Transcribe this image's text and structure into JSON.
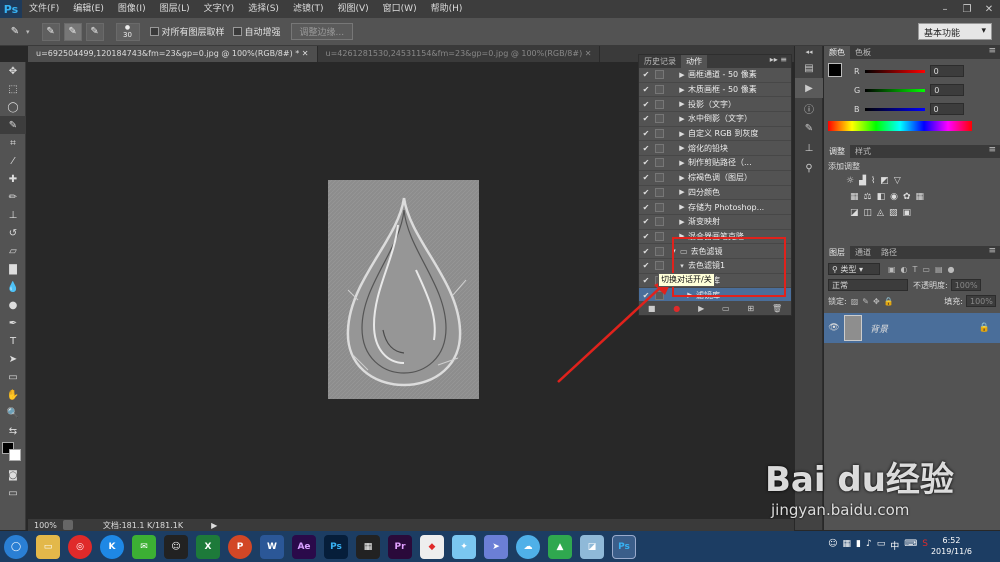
{
  "app": {
    "logo": "Ps"
  },
  "menu": [
    "文件(F)",
    "编辑(E)",
    "图像(I)",
    "图层(L)",
    "文字(Y)",
    "选择(S)",
    "滤镜(T)",
    "视图(V)",
    "窗口(W)",
    "帮助(H)"
  ],
  "options": {
    "brush_size": "30",
    "sample_all_layers": "对所有图层取样",
    "auto_enhance": "自动增强",
    "refine_edge": "调整边缘...",
    "workspace": "基本功能"
  },
  "doc_tabs": [
    "u=692504499,120184743&fm=23&gp=0.jpg @ 100%(RGB/8#) *",
    "u=4261281530,24531154&fm=23&gp=0.jpg @ 100%(RGB/8#)"
  ],
  "status": {
    "zoom": "100%",
    "doc_info": "文档:181.1 K/181.1K"
  },
  "actions_panel": {
    "tabs": [
      "历史记录",
      "动作"
    ],
    "rows": [
      {
        "label": "画框通道 - 50 像素"
      },
      {
        "label": "木质画框 - 50 像素"
      },
      {
        "label": "投影（文字）"
      },
      {
        "label": "水中倒影（文字）"
      },
      {
        "label": "自定义 RGB 到灰度"
      },
      {
        "label": "熔化的铅块"
      },
      {
        "label": "制作剪贴路径（..."
      },
      {
        "label": "棕褐色调（图层）"
      },
      {
        "label": "四分颜色"
      },
      {
        "label": "存储为 Photoshop..."
      },
      {
        "label": "渐变映射"
      },
      {
        "label": "混合器画笔克隆..."
      },
      {
        "label": "去色滤镜"
      },
      {
        "label": "去色滤镜1"
      },
      {
        "label": "滤镜库"
      },
      {
        "label": "滤镜库"
      }
    ],
    "tooltip": "切换对话开/关"
  },
  "color_panel": {
    "tabs": [
      "颜色",
      "色板"
    ],
    "r_label": "R",
    "g_label": "G",
    "b_label": "B",
    "r": "0",
    "g": "0",
    "b": "0"
  },
  "adjust_panel": {
    "tabs": [
      "调整",
      "样式"
    ],
    "title": "添加调整"
  },
  "layers_panel": {
    "tabs": [
      "图层",
      "通道",
      "路径"
    ],
    "filter": "类型",
    "blend_mode": "正常",
    "opacity_label": "不透明度:",
    "opacity": "100%",
    "lock_label": "锁定:",
    "fill_label": "填充:",
    "fill": "100%",
    "layer_name": "背景"
  },
  "taskbar": {
    "apps": [
      "Ae",
      "Ps",
      "Pr"
    ],
    "time": "6:52",
    "date": "2019/11/6",
    "ime": "中"
  },
  "watermark": {
    "brand": "Bai du经验",
    "url": "jingyan.baidu.com"
  },
  "colors": {
    "accent": "#e0221c",
    "selection": "#4a6e9a",
    "taskbar": "#1c3d63"
  }
}
